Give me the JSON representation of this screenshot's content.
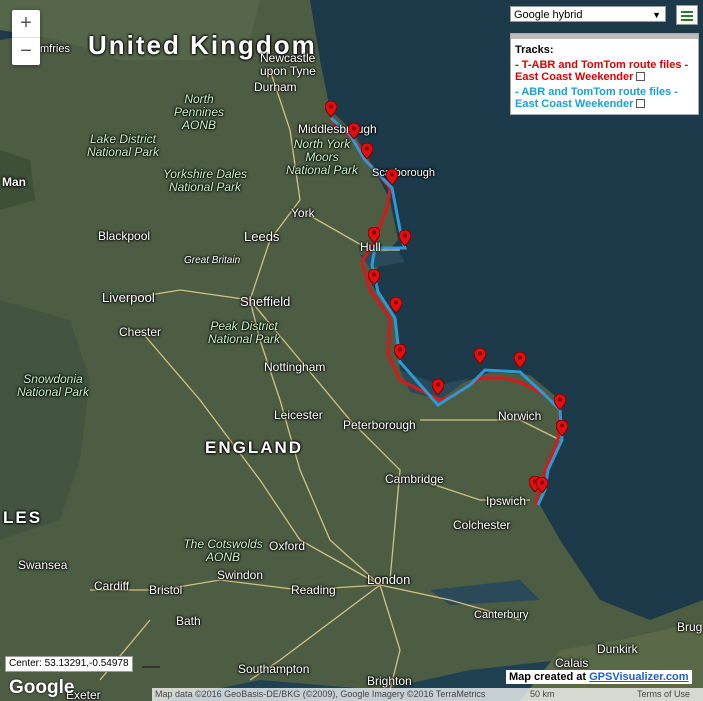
{
  "map": {
    "type_label": "Google hybrid",
    "colors": {
      "land": "#4d5d44",
      "sea": "#1c3a4a",
      "route_red": "#d61a1a",
      "route_blue": "#2d9ad6",
      "road": "#e9d28c"
    },
    "zoom_in": "+",
    "zoom_out": "−"
  },
  "tracks_panel": {
    "title": "Tracks:",
    "items": [
      {
        "label": "T-ABR and TomTom route files - East Coast Weekender",
        "color": "#d00000"
      },
      {
        "label": "ABR and TomTom route files - East Coast Weekender",
        "color": "#1a9fd4"
      }
    ]
  },
  "labels": {
    "united_kingdom": "United Kingdom",
    "england": "ENGLAND",
    "wales_fragment": "LES",
    "man": "Man",
    "cities": [
      "Newcastle upon Tyne",
      "Durham",
      "Middlesbrough",
      "Scarborough",
      "York",
      "Leeds",
      "Hull",
      "Blackpool",
      "Great Britain",
      "Liverpool",
      "Sheffield",
      "Chester",
      "Nottingham",
      "Leicester",
      "Peterborough",
      "Norwich",
      "Cambridge",
      "Ipswich",
      "Colchester",
      "Oxford",
      "Swindon",
      "Bristol",
      "Cardiff",
      "Swansea",
      "Bath",
      "London",
      "Reading",
      "Canterbury",
      "Southampton",
      "Brighton",
      "Calais",
      "Dunkirk",
      "Brug",
      "Exeter",
      "mfries"
    ],
    "parks": [
      "North Pennines AONB",
      "Lake District National Park",
      "North York Moors National Park",
      "Yorkshire Dales National Park",
      "Peak District National Park",
      "Snowdonia National Park",
      "The Cotswolds AONB"
    ]
  },
  "footer": {
    "center": "Center: 53.13291,-0.54978",
    "google": "Google",
    "created_prefix": "Map created at",
    "created_link": "GPSVisualizer.com",
    "attribution": "Map data ©2016 GeoBasis-DE/BKG (©2009), Google Imagery ©2016 TerraMetrics",
    "scale": "50 km",
    "terms": "Terms of Use"
  }
}
